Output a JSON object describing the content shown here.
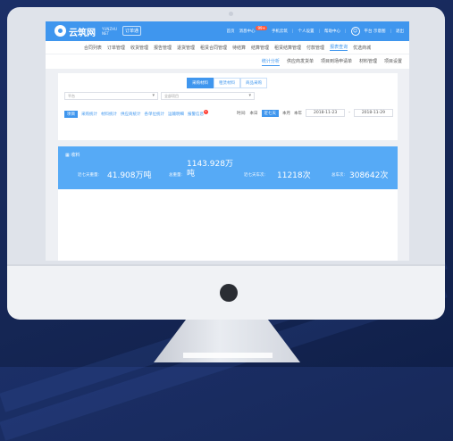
{
  "header": {
    "brand": "云筑网",
    "brand_sub": "YUNZHU NET",
    "mall_button": "订单通",
    "links": [
      "首页",
      "消息中心",
      "手机云筑",
      "个人设置",
      "帮助中心"
    ],
    "message_badge": "99+",
    "user_name": "平台 示意图",
    "logout": "退出"
  },
  "nav": {
    "items": [
      "合同列表",
      "订单管理",
      "收货管理",
      "报告管理",
      "退货管理",
      "租赁合同管理",
      "待结算",
      "结算管理",
      "租赁结算管理",
      "付款管理",
      "报表查询",
      "优选商城"
    ],
    "active_index": 10
  },
  "subnav": {
    "tabs": [
      "统计分析",
      "供应商发货单",
      "项目到场申请单",
      "材料管理",
      "项目设置"
    ],
    "active_index": 0
  },
  "filter_card": {
    "segments": [
      "采购材料",
      "租赁材料",
      "商品采购"
    ],
    "active_segment": 0,
    "select1_placeholder": "平台",
    "select2_placeholder": "全部项目",
    "filters": [
      "项目",
      "采购统计",
      "材料统计",
      "供应商统计",
      "各单位统计",
      "运输明细",
      "报警信息"
    ],
    "active_filter": 0,
    "alert_badge": "5",
    "time_label": "时间:",
    "time_options": [
      "本日",
      "近七天",
      "本月",
      "本年"
    ],
    "active_time": 1,
    "date_from": "2018-11-23",
    "date_to": "2018-11-29"
  },
  "stats": {
    "title": "收料",
    "items": [
      {
        "label": "近七天重量:",
        "value": "41.908万吨"
      },
      {
        "label": "总重量:",
        "value": "1143.928万吨"
      },
      {
        "label": "近七天车次:",
        "value": "11218次"
      },
      {
        "label": "总车次:",
        "value": "308642次"
      }
    ]
  }
}
